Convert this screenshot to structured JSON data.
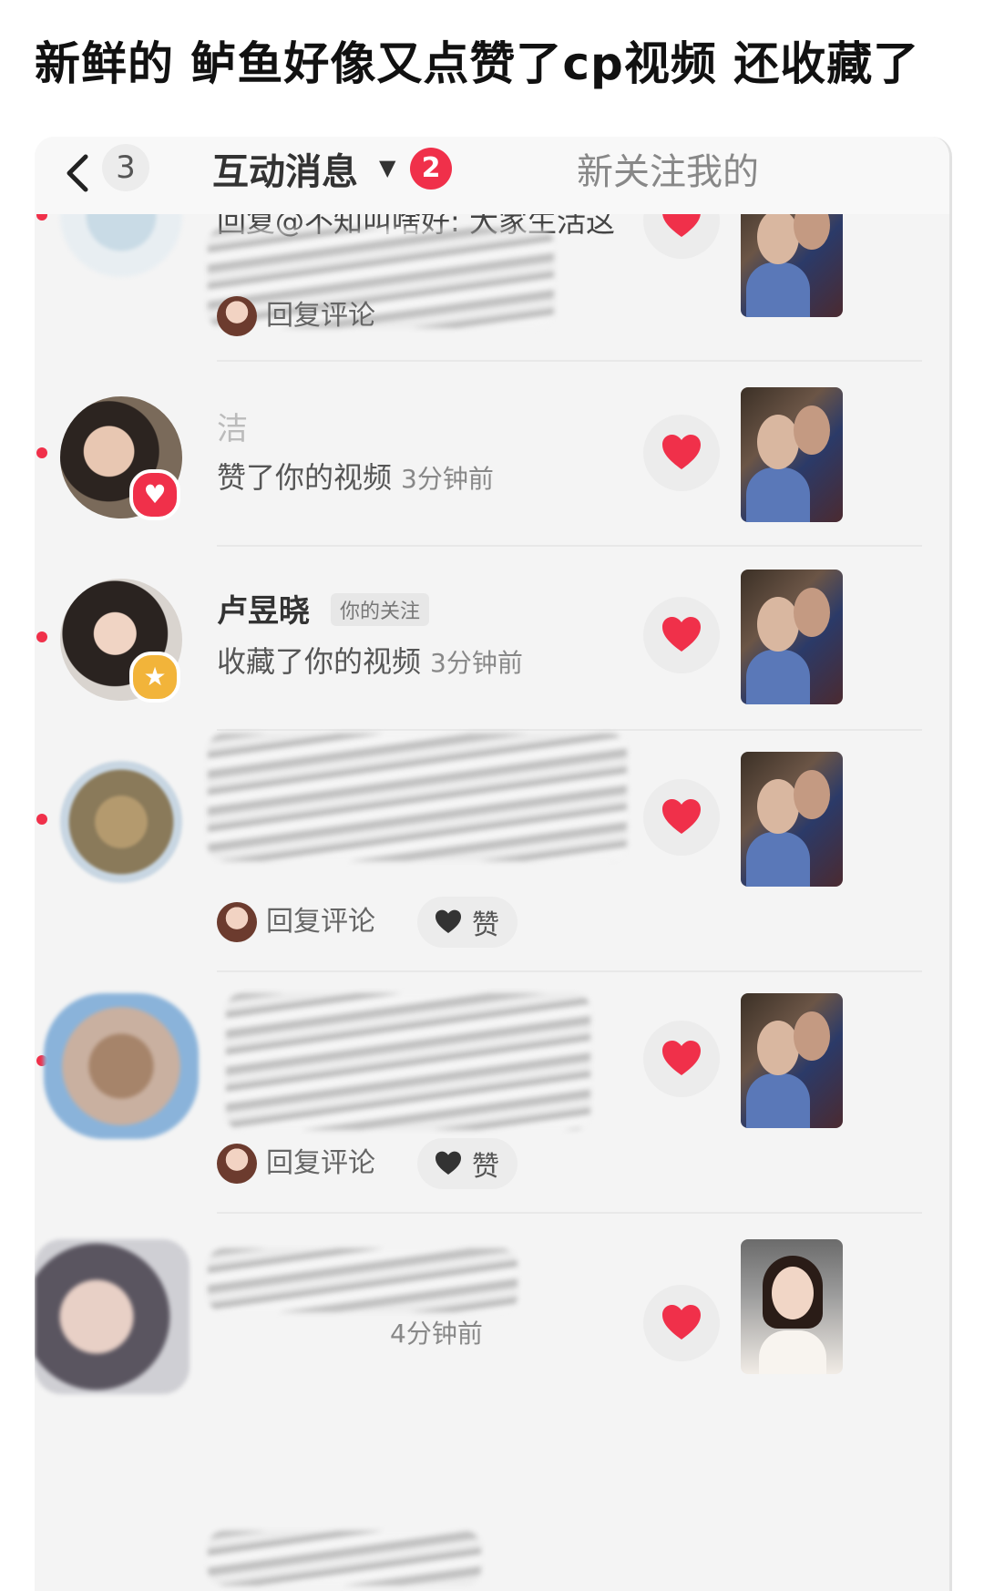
{
  "caption": "新鲜的 鲈鱼好像又点赞了cp视频 还收藏了",
  "nav": {
    "back_count": "3",
    "tab_interactions": "互动消息",
    "tab_badge": "2",
    "tab_new_followers": "新关注我的"
  },
  "items": [
    {
      "action": "回复@不知叫啥好: 大家生活这",
      "reply_label": "回复评论"
    },
    {
      "username": "洁",
      "action": "赞了你的视频",
      "time": "3分钟前",
      "badge_icon": "heart-icon"
    },
    {
      "username": "卢昱晓",
      "follow_tag": "你的关注",
      "action": "收藏了你的视频",
      "time": "3分钟前",
      "badge_icon": "star-icon"
    },
    {
      "reply_label": "回复评论",
      "like_label": "赞"
    },
    {
      "reply_label": "回复评论",
      "like_label": "赞"
    },
    {
      "time": "4分钟前"
    }
  ],
  "colors": {
    "accent_red": "#f0304a",
    "star_badge": "#f2b43a",
    "heart_badge": "#f0304a"
  }
}
